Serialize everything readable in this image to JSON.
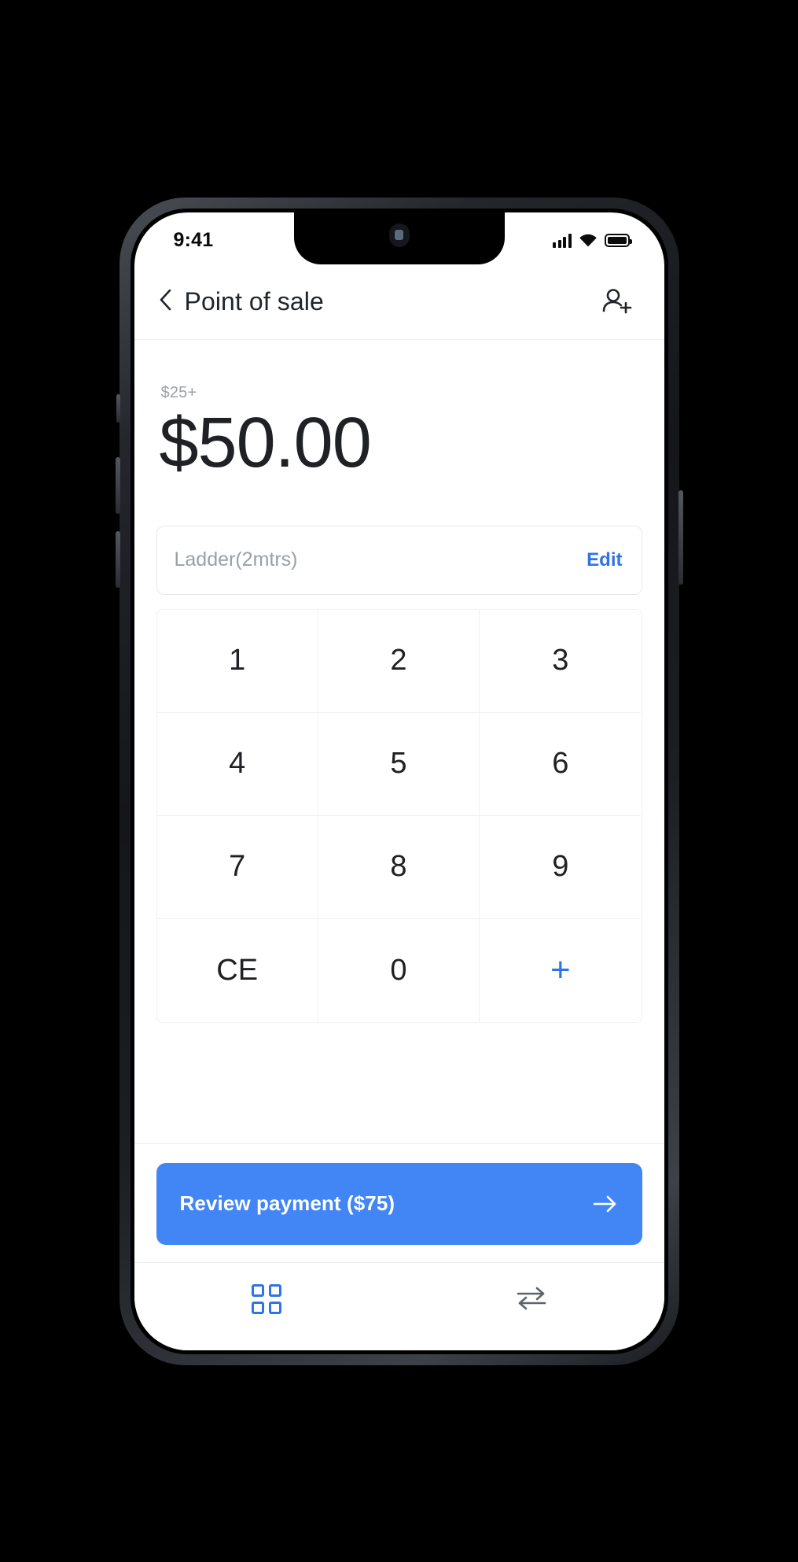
{
  "status_bar": {
    "time": "9:41",
    "icons": [
      "cellular-signal-icon",
      "wifi-icon",
      "battery-icon"
    ]
  },
  "header": {
    "back_icon": "chevron-left-icon",
    "title": "Point of sale",
    "action_icon": "add-person-icon"
  },
  "amount": {
    "hint": "$25+",
    "value": "$50.00"
  },
  "item": {
    "name": "Ladder(2mtrs)",
    "edit_label": "Edit"
  },
  "keypad": {
    "keys": [
      {
        "label": "1",
        "accent": false
      },
      {
        "label": "2",
        "accent": false
      },
      {
        "label": "3",
        "accent": false
      },
      {
        "label": "4",
        "accent": false
      },
      {
        "label": "5",
        "accent": false
      },
      {
        "label": "6",
        "accent": false
      },
      {
        "label": "7",
        "accent": false
      },
      {
        "label": "8",
        "accent": false
      },
      {
        "label": "9",
        "accent": false
      },
      {
        "label": "CE",
        "accent": false
      },
      {
        "label": "0",
        "accent": false
      },
      {
        "label": "+",
        "accent": true
      }
    ]
  },
  "cta": {
    "label": "Review payment ($75)",
    "arrow_icon": "arrow-right-icon"
  },
  "tab_bar": {
    "tabs": [
      {
        "icon": "grid-apps-icon",
        "active": true
      },
      {
        "icon": "transfer-arrows-icon",
        "active": false
      }
    ]
  },
  "colors": {
    "accent": "#2f73e8",
    "cta_background": "#4285f4",
    "text_primary": "#202124",
    "text_muted": "#9aa0a6",
    "page_background": "#000000",
    "screen_background": "#ffffff"
  }
}
